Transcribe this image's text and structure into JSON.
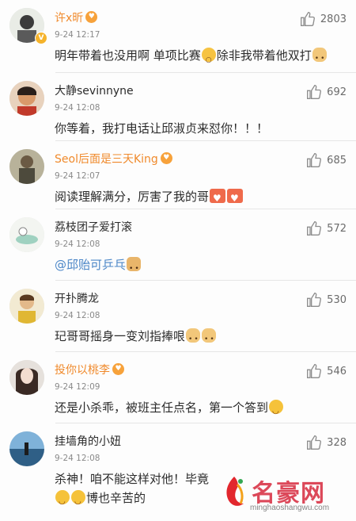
{
  "comments": [
    {
      "name": "许x昕",
      "vip": true,
      "verified": true,
      "time": "9-24 12:17",
      "text_parts": [
        "明年带着也没用啊 单项比赛",
        "除非我带着他双打"
      ],
      "emojis": [
        "scream",
        "doge"
      ],
      "likes": "2803",
      "avatar_color": "#cfd6cc"
    },
    {
      "name": "大静sevinnyne",
      "vip": false,
      "verified": false,
      "time": "9-24 12:08",
      "text": "你等着，我打电话让邱淑贞来怼你！！！",
      "likes": "692",
      "avatar_color": "#d98b56"
    },
    {
      "name": "Seol后面是三天King",
      "vip": true,
      "verified": false,
      "time": "9-24 12:07",
      "text": "阅读理解满分，厉害了我的哥",
      "emojis": [
        "heart",
        "heart"
      ],
      "likes": "685",
      "avatar_color": "#8a8a6a"
    },
    {
      "name": "荔枝团子爱打滚",
      "vip": false,
      "verified": false,
      "time": "9-24 12:08",
      "mention": "@邱贻可乒乓",
      "emojis": [
        "cat"
      ],
      "likes": "572",
      "avatar_color": "#eef1ec"
    },
    {
      "name": "开扑腾龙",
      "vip": false,
      "verified": false,
      "time": "9-24 12:08",
      "text": "玘哥哥摇身一变刘指捧哏",
      "emojis": [
        "doge",
        "doge"
      ],
      "likes": "530",
      "avatar_color": "#d9c28a"
    },
    {
      "name": "投你以桃李",
      "vip": true,
      "verified": false,
      "time": "9-24 12:09",
      "text": "还是小杀乖，被班主任点名，第一个答到",
      "emojis": [
        "laugh"
      ],
      "likes": "546",
      "avatar_color": "#c8c2bd"
    },
    {
      "name": "挂墙角的小妞",
      "vip": false,
      "verified": false,
      "time": "9-24 12:08",
      "text": "杀神！咱不能这样对他！毕竟",
      "text2": "博也辛苦的",
      "emojis": [
        "laugh",
        "laugh"
      ],
      "likes": "328",
      "avatar_color": "#4f7fa8"
    }
  ],
  "watermark": {
    "title": "名豪网",
    "url": "minghaoshangwu.com"
  },
  "colors": {
    "vip_name": "#f08a2c",
    "mention": "#4b86c7",
    "meta": "#8a8a8a",
    "divider": "#e6e6e6"
  },
  "icons": {
    "like": "thumbs-up-icon",
    "verified": "verified-badge-icon",
    "vip": "vip-heart-icon"
  }
}
